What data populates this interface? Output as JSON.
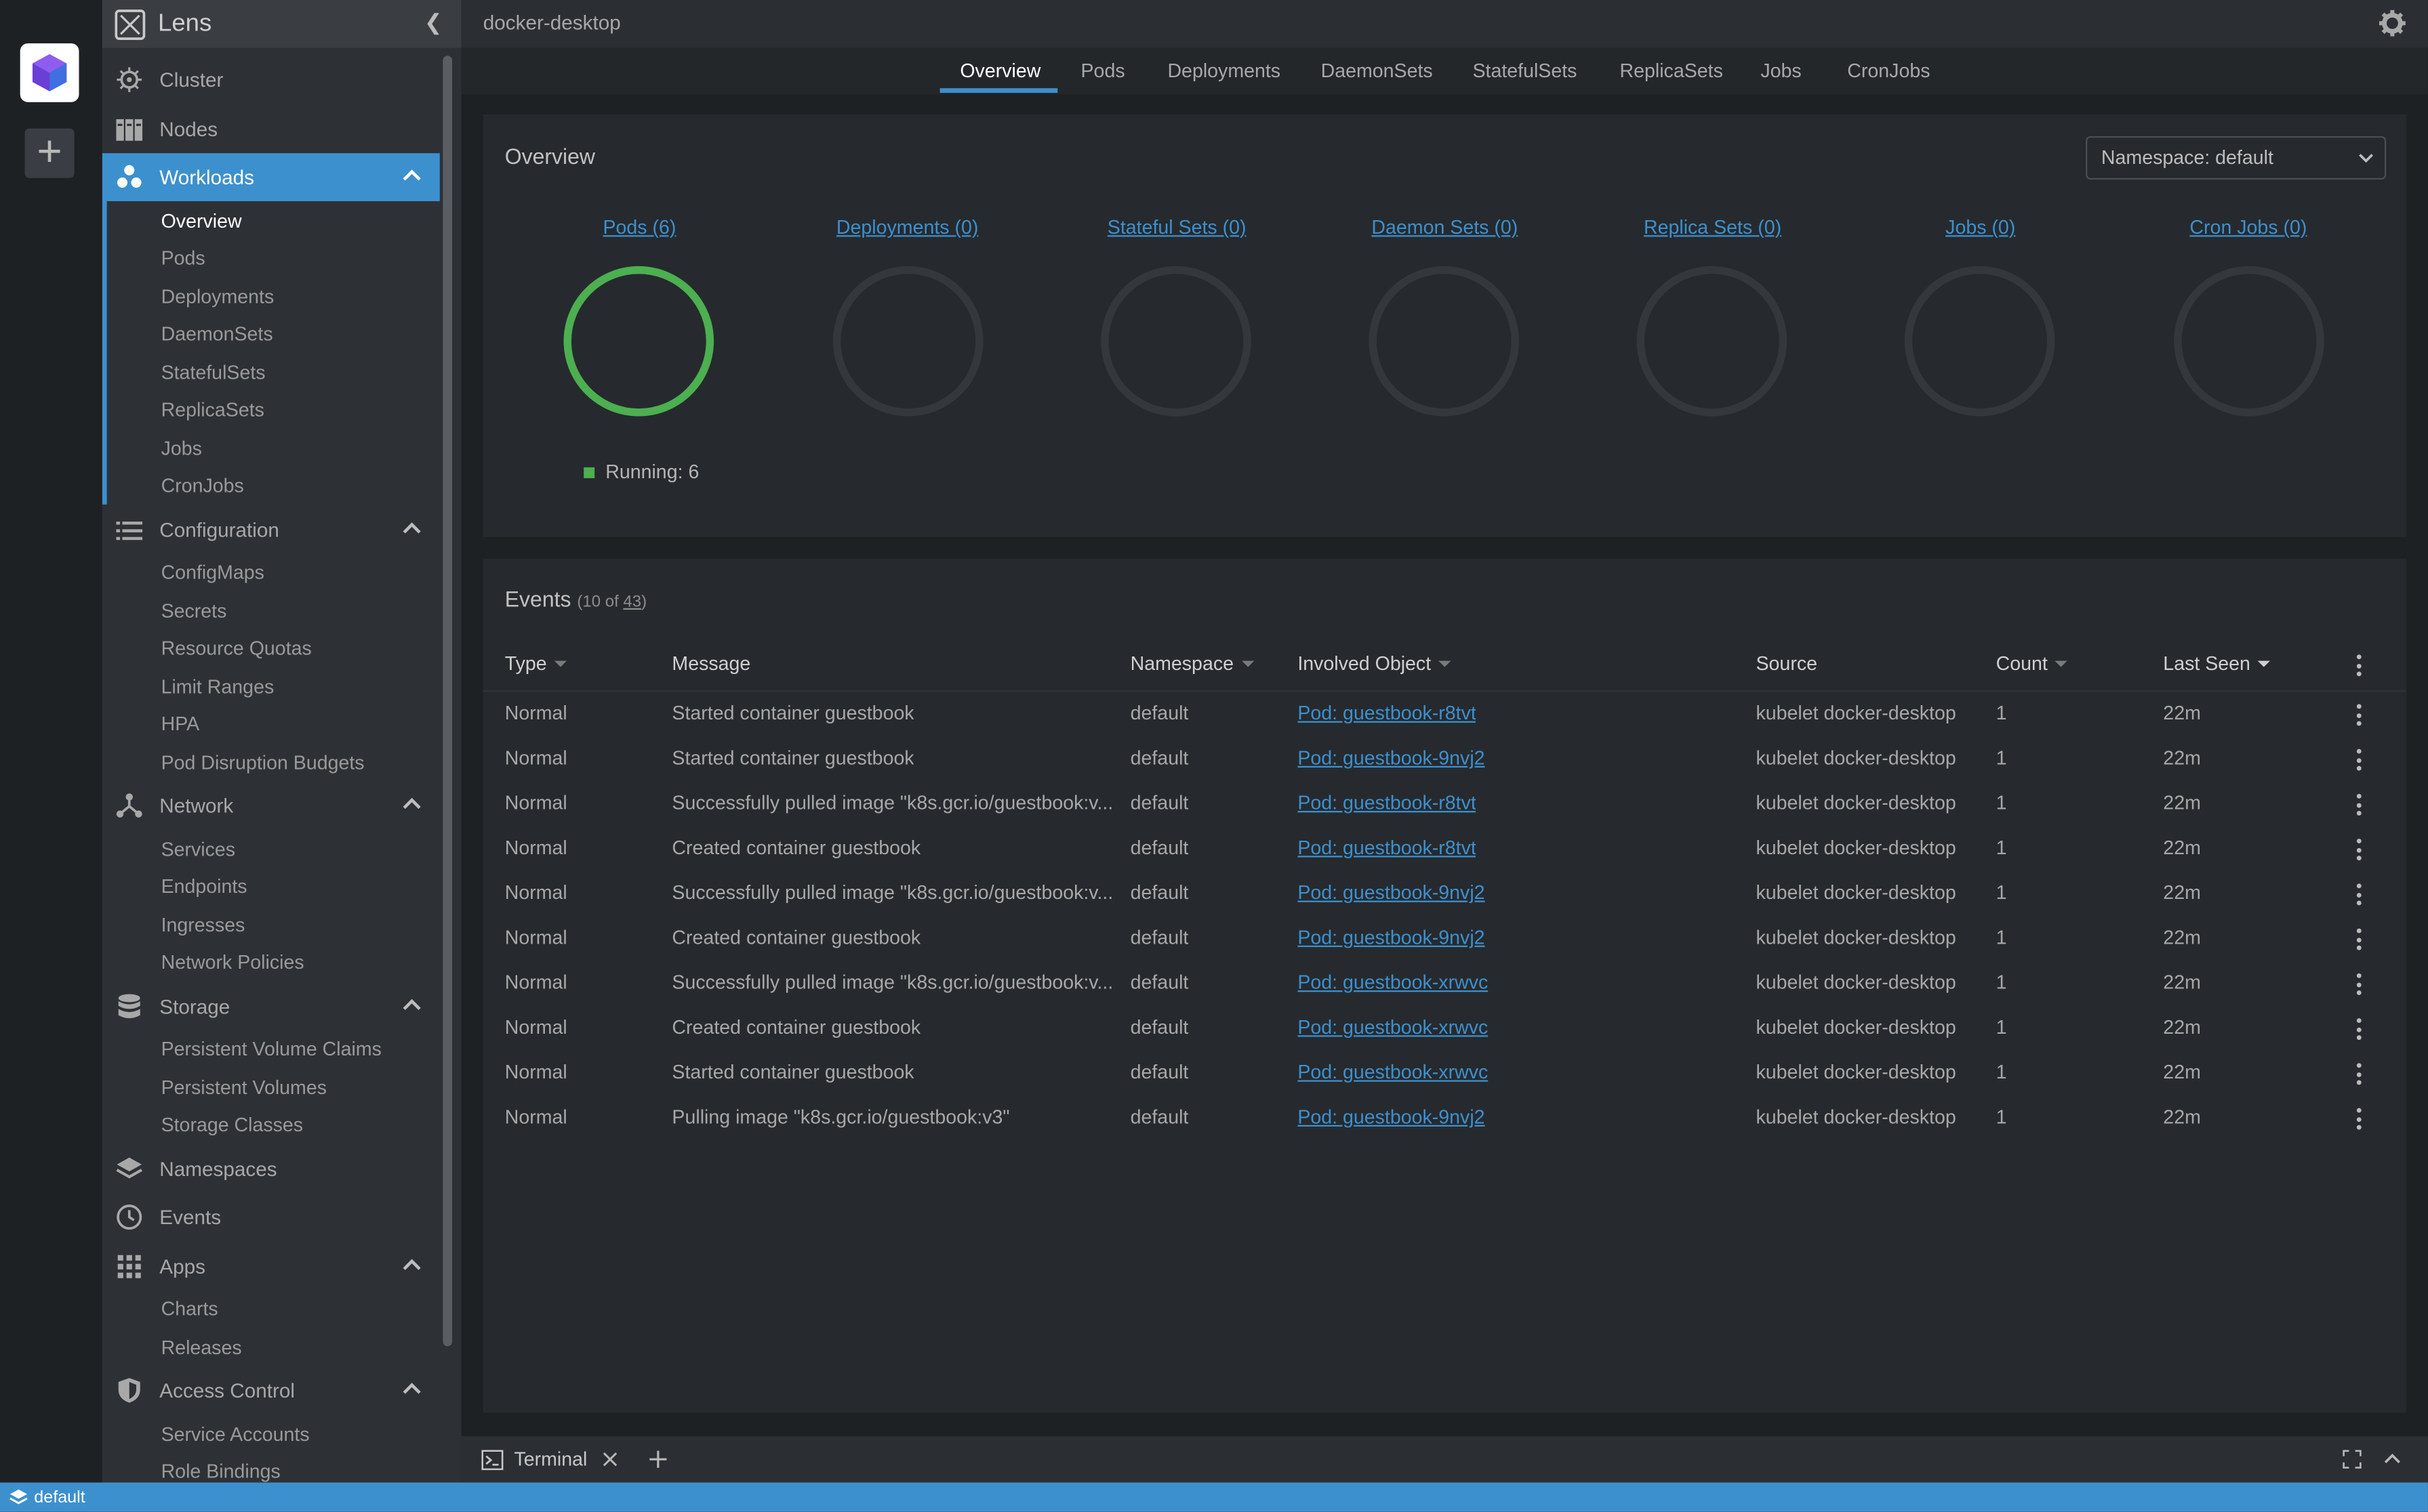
{
  "app": {
    "name": "Lens",
    "context": "docker-desktop"
  },
  "sidebar": {
    "sections": [
      {
        "label": "Cluster",
        "icon": "helm-wheel-icon"
      },
      {
        "label": "Nodes",
        "icon": "nodes-icon"
      },
      {
        "label": "Workloads",
        "icon": "workloads-icon",
        "expanded": true
      },
      {
        "label": "Configuration",
        "icon": "list-icon",
        "expanded": true
      },
      {
        "label": "Network",
        "icon": "network-icon",
        "expanded": true
      },
      {
        "label": "Storage",
        "icon": "database-icon",
        "expanded": true
      },
      {
        "label": "Namespaces",
        "icon": "layers-icon"
      },
      {
        "label": "Events",
        "icon": "clock-icon"
      },
      {
        "label": "Apps",
        "icon": "apps-grid-icon",
        "expanded": true
      },
      {
        "label": "Access Control",
        "icon": "shield-icon",
        "expanded": true
      }
    ],
    "workloads": [
      "Overview",
      "Pods",
      "Deployments",
      "DaemonSets",
      "StatefulSets",
      "ReplicaSets",
      "Jobs",
      "CronJobs"
    ],
    "configuration": [
      "ConfigMaps",
      "Secrets",
      "Resource Quotas",
      "Limit Ranges",
      "HPA",
      "Pod Disruption Budgets"
    ],
    "network": [
      "Services",
      "Endpoints",
      "Ingresses",
      "Network Policies"
    ],
    "storage": [
      "Persistent Volume Claims",
      "Persistent Volumes",
      "Storage Classes"
    ],
    "apps": [
      "Charts",
      "Releases"
    ],
    "access_control": [
      "Service Accounts",
      "Role Bindings"
    ]
  },
  "tabs": [
    "Overview",
    "Pods",
    "Deployments",
    "DaemonSets",
    "StatefulSets",
    "ReplicaSets",
    "Jobs",
    "CronJobs"
  ],
  "overview": {
    "title": "Overview",
    "namespace_select": "Namespace: default",
    "workloads": [
      {
        "label": "Pods (6)",
        "running": 6
      },
      {
        "label": "Deployments (0)"
      },
      {
        "label": "Stateful Sets (0)"
      },
      {
        "label": "Daemon Sets (0)"
      },
      {
        "label": "Replica Sets (0)"
      },
      {
        "label": "Jobs (0)"
      },
      {
        "label": "Cron Jobs (0)"
      }
    ],
    "legend": "Running: 6",
    "legend_color": "#4caf50"
  },
  "events": {
    "title": "Events",
    "count_prefix": "(10 of ",
    "count_total": "43",
    "count_suffix": ")",
    "columns": [
      "Type",
      "Message",
      "Namespace",
      "Involved Object",
      "Source",
      "Count",
      "Last Seen"
    ],
    "rows": [
      [
        "Normal",
        "Started container guestbook",
        "default",
        "Pod: guestbook-r8tvt",
        "kubelet docker-desktop",
        "1",
        "22m"
      ],
      [
        "Normal",
        "Started container guestbook",
        "default",
        "Pod: guestbook-9nvj2",
        "kubelet docker-desktop",
        "1",
        "22m"
      ],
      [
        "Normal",
        "Successfully pulled image \"k8s.gcr.io/guestbook:v...",
        "default",
        "Pod: guestbook-r8tvt",
        "kubelet docker-desktop",
        "1",
        "22m"
      ],
      [
        "Normal",
        "Created container guestbook",
        "default",
        "Pod: guestbook-r8tvt",
        "kubelet docker-desktop",
        "1",
        "22m"
      ],
      [
        "Normal",
        "Successfully pulled image \"k8s.gcr.io/guestbook:v...",
        "default",
        "Pod: guestbook-9nvj2",
        "kubelet docker-desktop",
        "1",
        "22m"
      ],
      [
        "Normal",
        "Created container guestbook",
        "default",
        "Pod: guestbook-9nvj2",
        "kubelet docker-desktop",
        "1",
        "22m"
      ],
      [
        "Normal",
        "Successfully pulled image \"k8s.gcr.io/guestbook:v...",
        "default",
        "Pod: guestbook-xrwvc",
        "kubelet docker-desktop",
        "1",
        "22m"
      ],
      [
        "Normal",
        "Created container guestbook",
        "default",
        "Pod: guestbook-xrwvc",
        "kubelet docker-desktop",
        "1",
        "22m"
      ],
      [
        "Normal",
        "Started container guestbook",
        "default",
        "Pod: guestbook-xrwvc",
        "kubelet docker-desktop",
        "1",
        "22m"
      ],
      [
        "Normal",
        "Pulling image \"k8s.gcr.io/guestbook:v3\"",
        "default",
        "Pod: guestbook-9nvj2",
        "kubelet docker-desktop",
        "1",
        "22m"
      ]
    ]
  },
  "dock": {
    "tab_label": "Terminal"
  },
  "statusbar": {
    "namespace": "default"
  },
  "colors": {
    "accent": "#3d90ce",
    "running": "#4caf50",
    "background": "#1e2124"
  }
}
